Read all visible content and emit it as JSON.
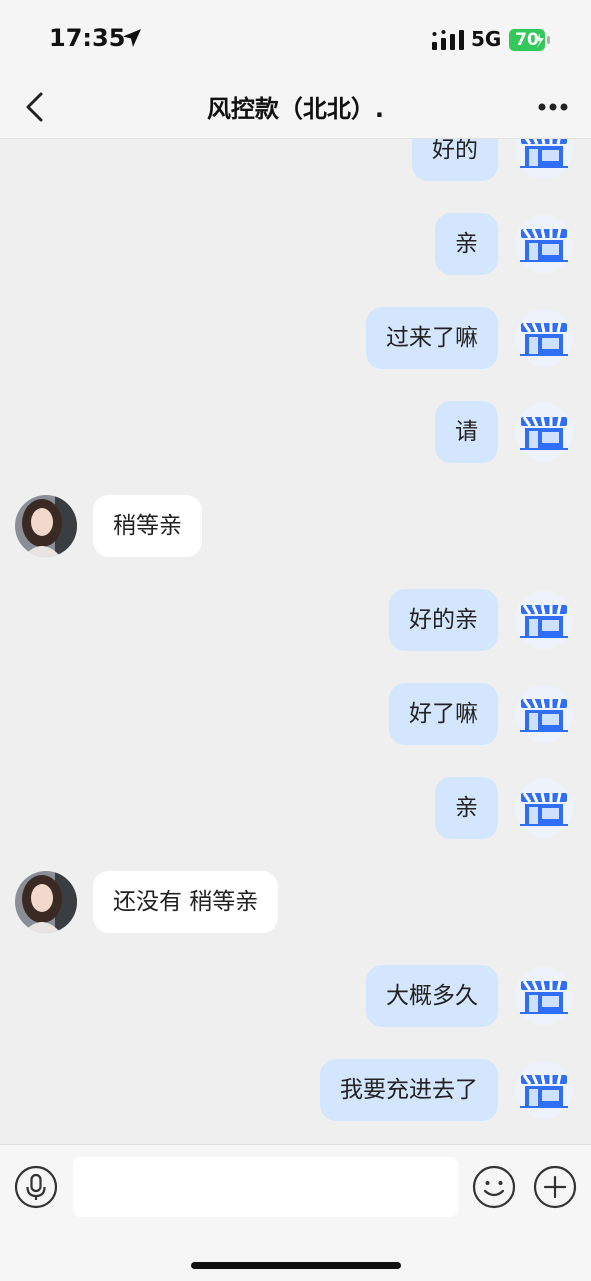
{
  "status_bar": {
    "time": "17:35",
    "network": "5G",
    "battery": "70"
  },
  "header": {
    "title": "风控款（北北）."
  },
  "messages": [
    {
      "side": "mine",
      "text": "好的"
    },
    {
      "side": "mine",
      "text": "亲"
    },
    {
      "side": "mine",
      "text": "过来了嘛"
    },
    {
      "side": "mine",
      "text": "请"
    },
    {
      "side": "theirs",
      "text": "稍等亲"
    },
    {
      "side": "mine",
      "text": "好的亲"
    },
    {
      "side": "mine",
      "text": "好了嘛"
    },
    {
      "side": "mine",
      "text": "亲"
    },
    {
      "side": "theirs",
      "text": "还没有 稍等亲"
    },
    {
      "side": "mine",
      "text": "大概多久"
    },
    {
      "side": "mine",
      "text": "我要充进去了"
    }
  ],
  "input": {
    "placeholder": ""
  },
  "colors": {
    "my_bubble": "#d4e6fd",
    "their_bubble": "#ffffff",
    "store_icon_blue": "#2f6ef5",
    "background": "#efefef"
  }
}
